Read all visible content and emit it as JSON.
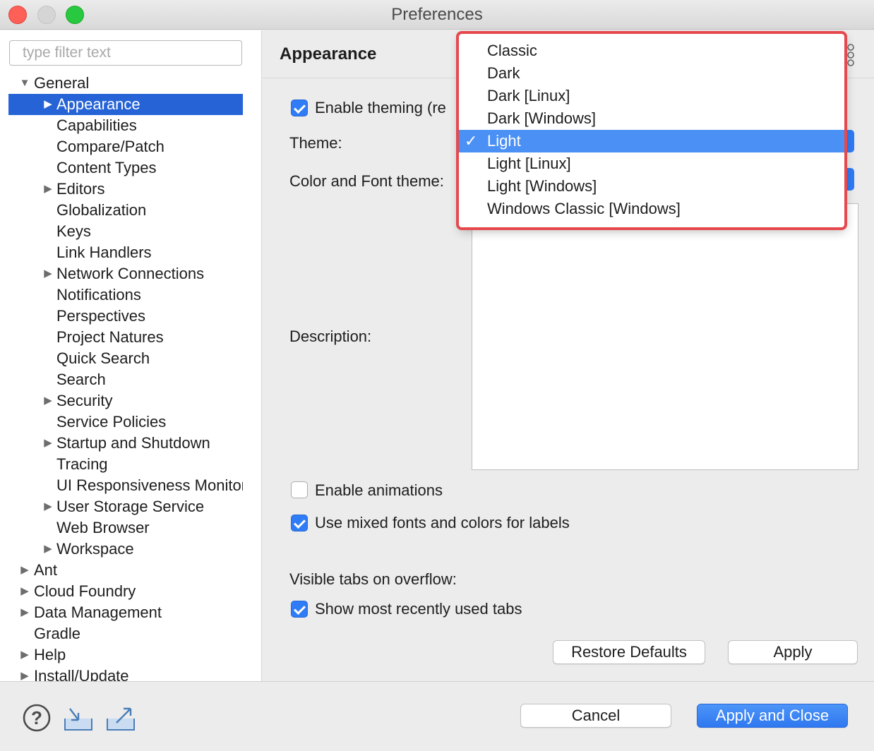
{
  "window": {
    "title": "Preferences"
  },
  "filter": {
    "placeholder": "type filter text"
  },
  "tree": [
    {
      "label": "General",
      "level": 0,
      "expandable": true,
      "expanded": true
    },
    {
      "label": "Appearance",
      "level": 1,
      "expandable": true,
      "selected": true
    },
    {
      "label": "Capabilities",
      "level": 1
    },
    {
      "label": "Compare/Patch",
      "level": 1
    },
    {
      "label": "Content Types",
      "level": 1
    },
    {
      "label": "Editors",
      "level": 1,
      "expandable": true
    },
    {
      "label": "Globalization",
      "level": 1
    },
    {
      "label": "Keys",
      "level": 1
    },
    {
      "label": "Link Handlers",
      "level": 1
    },
    {
      "label": "Network Connections",
      "level": 1,
      "expandable": true
    },
    {
      "label": "Notifications",
      "level": 1
    },
    {
      "label": "Perspectives",
      "level": 1
    },
    {
      "label": "Project Natures",
      "level": 1
    },
    {
      "label": "Quick Search",
      "level": 1
    },
    {
      "label": "Search",
      "level": 1
    },
    {
      "label": "Security",
      "level": 1,
      "expandable": true
    },
    {
      "label": "Service Policies",
      "level": 1
    },
    {
      "label": "Startup and Shutdown",
      "level": 1,
      "expandable": true
    },
    {
      "label": "Tracing",
      "level": 1
    },
    {
      "label": "UI Responsiveness Monitoring",
      "level": 1
    },
    {
      "label": "User Storage Service",
      "level": 1,
      "expandable": true
    },
    {
      "label": "Web Browser",
      "level": 1
    },
    {
      "label": "Workspace",
      "level": 1,
      "expandable": true
    },
    {
      "label": "Ant",
      "level": 0,
      "expandable": true
    },
    {
      "label": "Cloud Foundry",
      "level": 0,
      "expandable": true
    },
    {
      "label": "Data Management",
      "level": 0,
      "expandable": true
    },
    {
      "label": "Gradle",
      "level": 0
    },
    {
      "label": "Help",
      "level": 0,
      "expandable": true
    },
    {
      "label": "Install/Update",
      "level": 0,
      "expandable": true
    }
  ],
  "page": {
    "title": "Appearance",
    "enable_theming_label": "Enable theming (re",
    "theme_label": "Theme:",
    "color_font_theme_label": "Color and Font theme:",
    "description_label": "Description:",
    "enable_animations_label": "Enable animations",
    "mixed_fonts_label": "Use mixed fonts and colors for labels",
    "visible_tabs_label": "Visible tabs on overflow:",
    "show_recent_tabs_label": "Show most recently used tabs",
    "restore_defaults_label": "Restore Defaults",
    "apply_label": "Apply"
  },
  "theme_dropdown": {
    "selected": "Light",
    "options": [
      "Classic",
      "Dark",
      "Dark [Linux]",
      "Dark [Windows]",
      "Light",
      "Light [Linux]",
      "Light [Windows]",
      "Windows Classic [Windows]"
    ]
  },
  "footer": {
    "cancel_label": "Cancel",
    "apply_close_label": "Apply and Close"
  },
  "colors": {
    "accent": "#2f7cf6",
    "selection": "#2563d6",
    "highlight_frame": "#e5484d"
  },
  "icons": [
    "help-icon",
    "import-icon",
    "export-icon",
    "more-icon"
  ]
}
